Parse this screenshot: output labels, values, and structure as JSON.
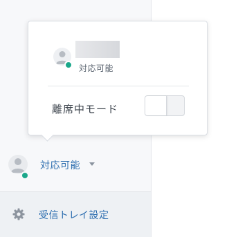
{
  "popover": {
    "status_label": "対応可能",
    "away_mode_label": "離席中モード",
    "away_mode_enabled": false
  },
  "sidebar": {
    "status_label": "対応可能",
    "inbox_settings_label": "受信トレイ設定"
  },
  "colors": {
    "online": "#1aa78a",
    "link": "#2f6fb0",
    "sidebar_bg": "#f7f8fa"
  },
  "icons": {
    "avatar": "user-avatar-icon",
    "caret": "caret-down-icon",
    "settings": "gear-icon"
  }
}
